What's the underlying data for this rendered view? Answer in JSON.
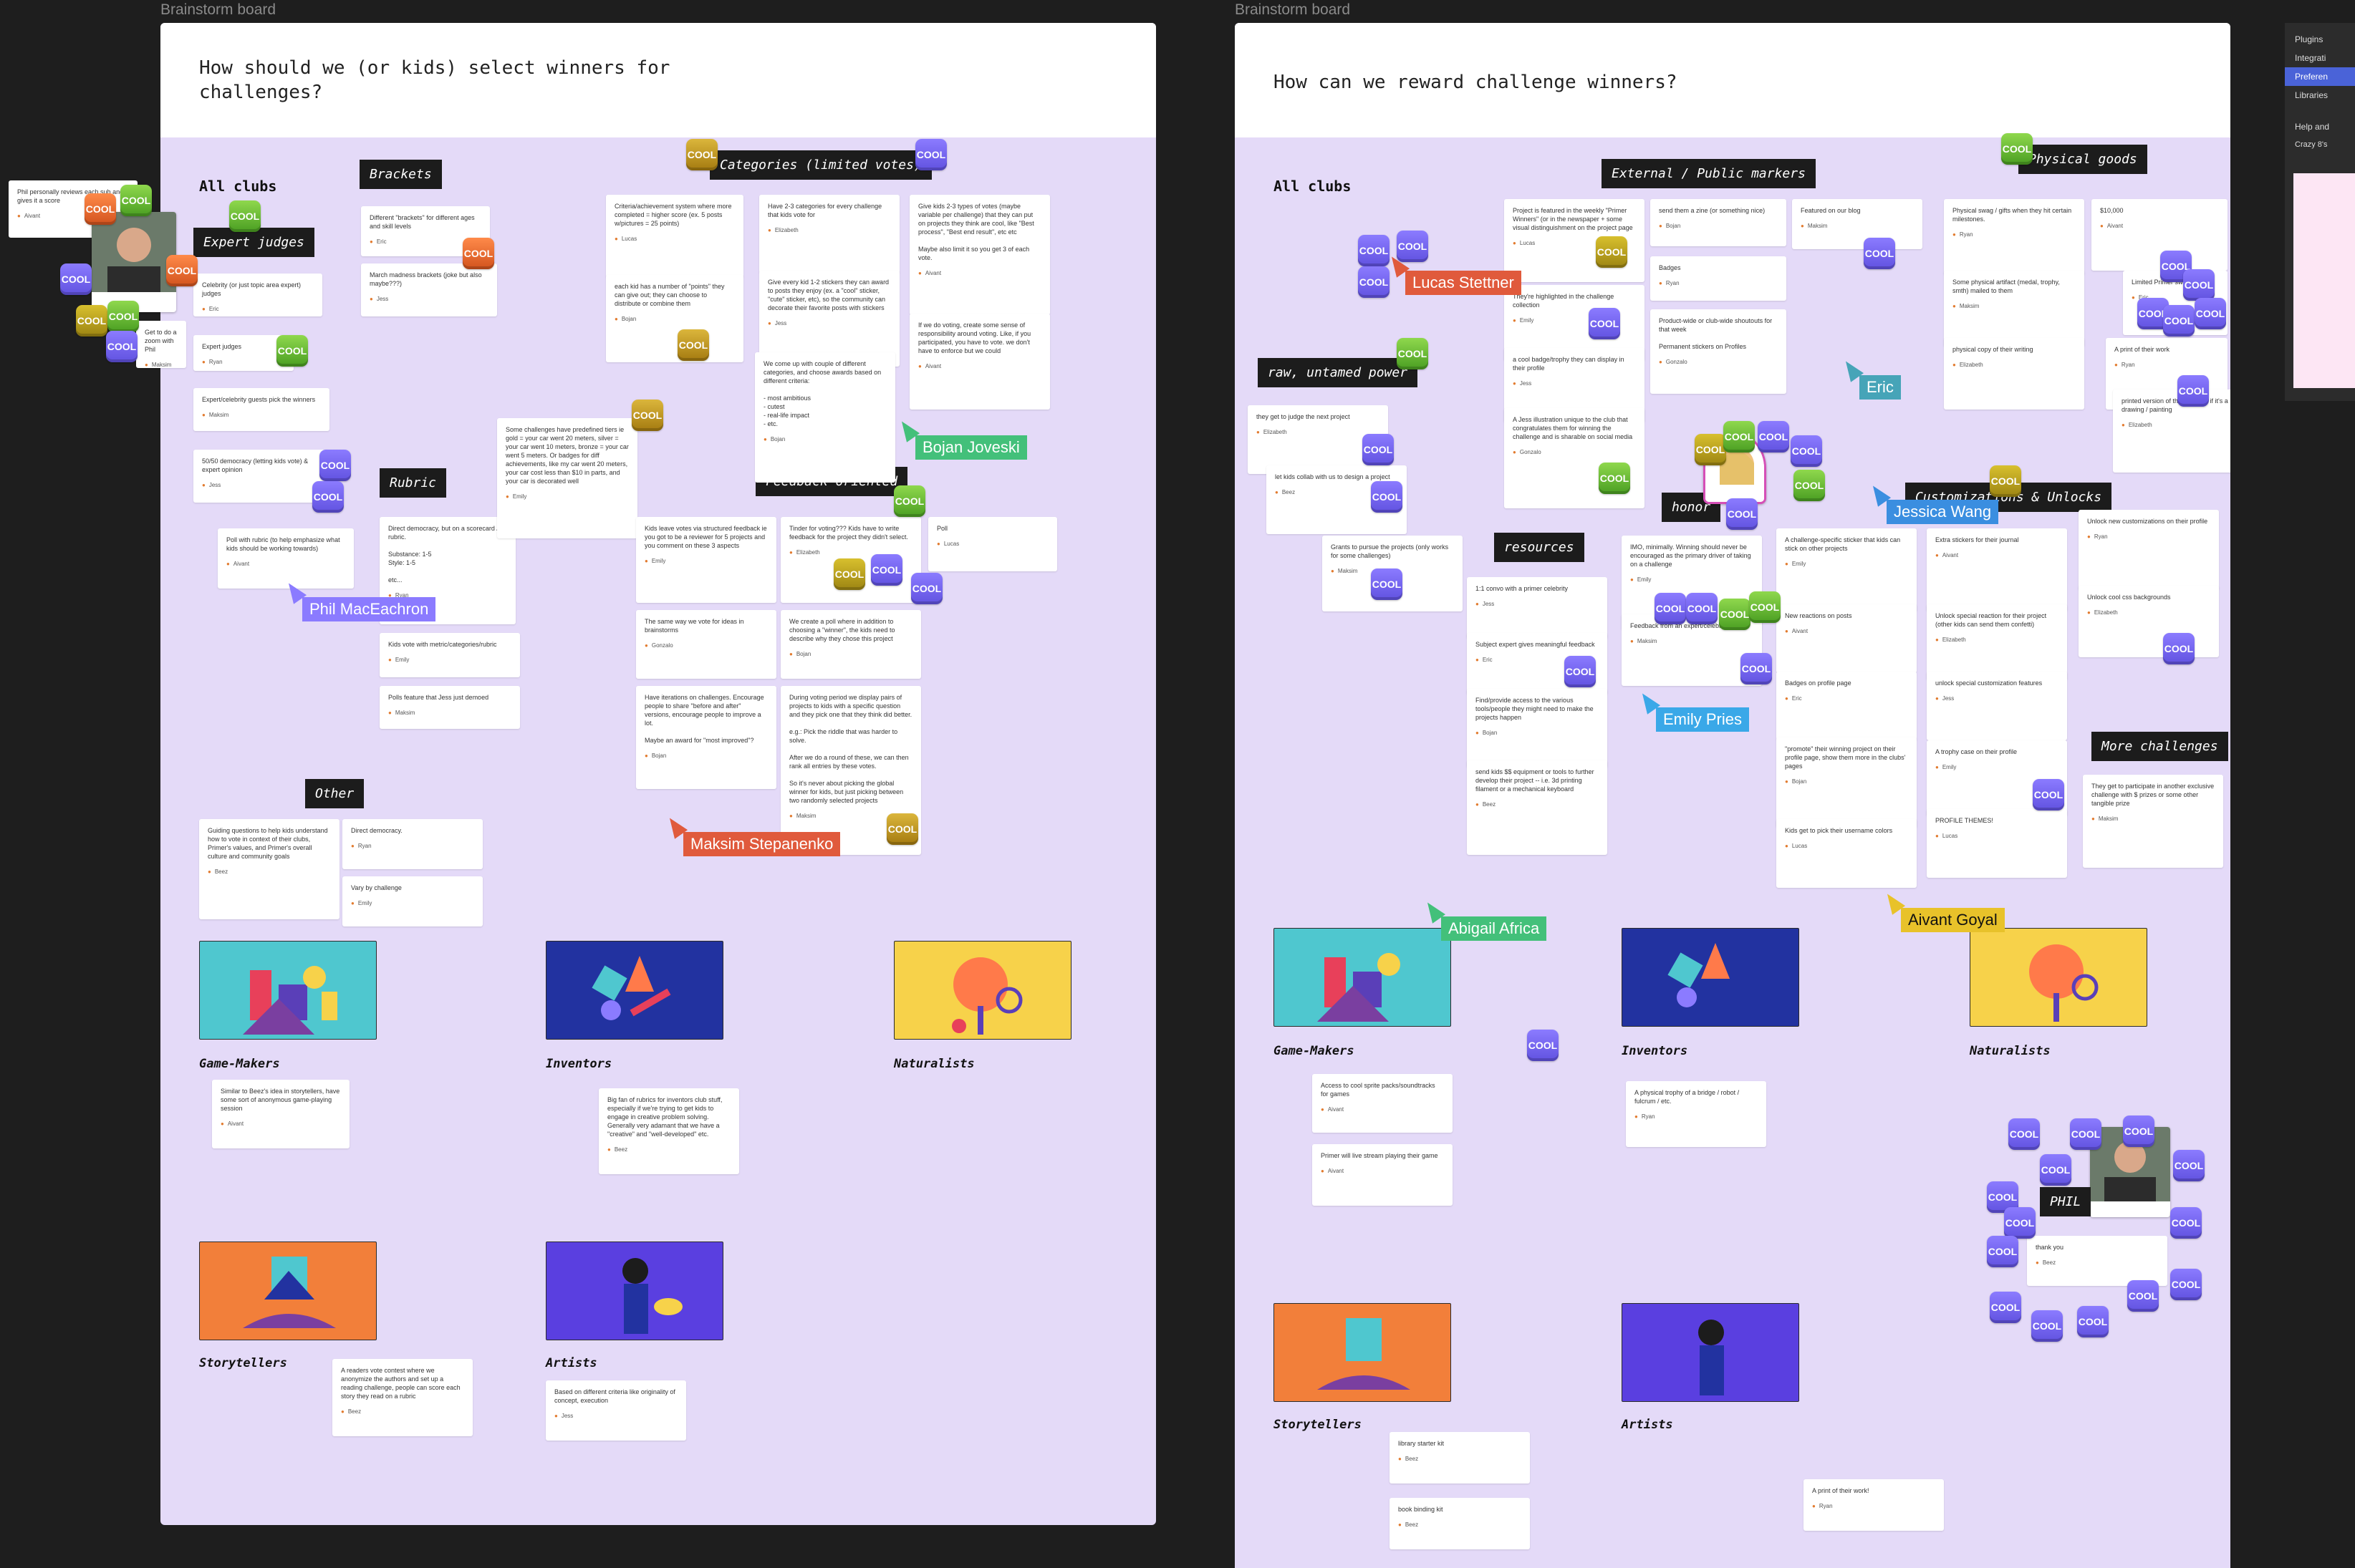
{
  "boards": [
    {
      "label": "Brainstorm board",
      "question": "How should we (or kids) select winners for\nchallenges?"
    },
    {
      "label": "Brainstorm board",
      "question": "How can we reward challenge winners?"
    }
  ],
  "sections": {
    "all_clubs": "All clubs"
  },
  "tags_left": {
    "brackets": "Brackets",
    "categories": "Categories (limited votes)",
    "expert": "Expert judges",
    "rubric": "Rubric",
    "feedback": "Feedback oriented",
    "other": "Other"
  },
  "tags_right": {
    "external": "External / Public markers",
    "physical": "Physical goods",
    "raw": "raw, untamed power",
    "resources": "resources",
    "honor": "honor",
    "unlocks": "Customizations & Unlocks",
    "more": "More challenges",
    "phil": "PHIL"
  },
  "cool_label": "COOL",
  "clubs": {
    "game": "Game-Makers",
    "inventors": "Inventors",
    "naturalists": "Naturalists",
    "story": "Storytellers",
    "artists": "Artists"
  },
  "cursors": {
    "phil": "Phil MacEachron",
    "bojan": "Bojan Joveski",
    "maksim": "Maksim Stepanenko",
    "lucas": "Lucas Stettner",
    "eric": "Eric",
    "jessica": "Jessica Wang",
    "emily": "Emily Pries",
    "abigail": "Abigail Africa",
    "aivant": "Aivant Goyal"
  },
  "notes_left": [
    {
      "t": "Phil personally reviews each sub and gives it a score",
      "a": "Aivant"
    },
    {
      "t": "Celebrity (or just topic area expert) judges",
      "a": "Eric"
    },
    {
      "t": "Expert judges",
      "a": "Ryan"
    },
    {
      "t": "Expert/celebrity guests pick the winners",
      "a": "Maksim"
    },
    {
      "t": "50/50 democracy (letting kids vote) &\nexpert opinion",
      "a": "Jess"
    },
    {
      "t": "Poll with rubric (to help emphasize what kids should be working towards)",
      "a": "Aivant"
    },
    {
      "t": "Different \"brackets\" for different ages and skill levels",
      "a": "Eric"
    },
    {
      "t": "March madness brackets (joke but also maybe???)",
      "a": "Jess"
    },
    {
      "t": "Direct democracy, but on a scorecard / rubric.\n\nSubstance: 1-5\nStyle: 1-5\n\netc...",
      "a": "Ryan"
    },
    {
      "t": "Kids vote with metric/categories/rubric",
      "a": "Emily"
    },
    {
      "t": "Polls feature that Jess just demoed",
      "a": "Maksim"
    },
    {
      "t": "Some challenges have predefined tiers ie gold = your car went 20 meters, silver = your car went 10 meters, bronze = your car went 5 meters. Or badges for diff achievements, like my car went 20 meters, your car cost less than $10 in parts, and your car is decorated well",
      "a": "Emily"
    },
    {
      "t": "Criteria/achievement system where more completed = higher score (ex. 5 posts w/pictures = 25 points)",
      "a": "Lucas"
    },
    {
      "t": "each kid has a number of \"points\" they can give out; they can choose to distribute or combine them",
      "a": "Bojan"
    },
    {
      "t": "Have 2-3 categories for every challenge that kids vote for",
      "a": "Elizabeth"
    },
    {
      "t": "Give every kid 1-2 stickers they can award to posts they enjoy (ex. a \"cool\" sticker, \"cute\" sticker, etc), so the community can decorate their favorite posts with stickers",
      "a": "Jess"
    },
    {
      "t": "We come up with couple of different categories, and choose awards based on different criteria:\n\n- most ambitious\n- cutest\n- real-life impact\n- etc.",
      "a": "Bojan"
    },
    {
      "t": "Give kids 2-3 types of votes (maybe variable per challenge) that they can put on projects they think are cool, like \"Best process\", \"Best end result\", etc etc\n\nMaybe also limit it so you get 3 of each vote.",
      "a": "Aivant"
    },
    {
      "t": "If we do voting, create some sense of responsibility around voting. Like, if you participated, you have to vote. we don't have to enforce but we could",
      "a": "Aivant"
    },
    {
      "t": "Kids leave votes via structured feedback ie you got to be a reviewer for 5 projects and you comment on these 3 aspects",
      "a": "Emily"
    },
    {
      "t": "Tinder for voting??? Kids have to write feedback for the project they didn't select.",
      "a": "Elizabeth"
    },
    {
      "t": "Poll",
      "a": "Lucas"
    },
    {
      "t": "The same way we vote for ideas in brainstorms",
      "a": "Gonzalo"
    },
    {
      "t": "We create a poll where in addition to choosing a \"winner\", the kids need to describe why they chose this project",
      "a": "Bojan"
    },
    {
      "t": "Have iterations on challenges. Encourage people to share \"before and after\" versions, encourage people to improve a lot.\n\nMaybe an award for \"most improved\"?",
      "a": "Bojan"
    },
    {
      "t": "During voting period we display pairs of projects to kids with a specific question and they pick one that they think did better.\n\ne.g.: Pick the riddle that was harder to solve.\n\nAfter we do a round of these, we can then rank all entries by these votes.\n\nSo it's never about picking the global winner for kids, but just picking between two randomly selected projects",
      "a": "Maksim"
    },
    {
      "t": "Guiding questions to help kids understand how to vote in context of their clubs, Primer's values, and Primer's overall culture and community goals",
      "a": "Beez"
    },
    {
      "t": "Direct democracy.",
      "a": "Ryan"
    },
    {
      "t": "Vary by challenge",
      "a": "Emily"
    },
    {
      "t": "Similar to Beez's idea in storytellers, have some sort of anonymous game-playing session",
      "a": "Aivant"
    },
    {
      "t": "Big fan of rubrics for inventors club stuff, especially if we're trying to get kids to engage in creative problem solving. Generally very adamant that we have a \"creative\" and \"well-developed\" etc.",
      "a": "Beez"
    },
    {
      "t": "A readers vote contest where we anonymize the authors and set up a reading challenge, people can score each story they read on a rubric",
      "a": "Beez"
    },
    {
      "t": "Based on different criteria like originality of concept, execution",
      "a": "Jess"
    }
  ],
  "notes_right": [
    {
      "t": "Project is featured in the weekly \"Primer Winners\" (or in the newspaper + some visual distinguishment on the project page",
      "a": "Lucas"
    },
    {
      "t": "send them a zine (or something nice)",
      "a": "Bojan"
    },
    {
      "t": "Featured on our blog",
      "a": "Maksim"
    },
    {
      "t": "Badges",
      "a": "Ryan"
    },
    {
      "t": "They're highlighted in the challenge collection",
      "a": "Emily"
    },
    {
      "t": "Product-wide or club-wide shoutouts for that week\n\nPermanent stickers on Profiles",
      "a": "Gonzalo"
    },
    {
      "t": "a cool badge/trophy they can display in their profile",
      "a": "Jess"
    },
    {
      "t": "A Jess illustration unique to the club that congratulates them for winning the challenge and is sharable on social media",
      "a": "Gonzalo"
    },
    {
      "t": "they get to judge the next project",
      "a": "Elizabeth"
    },
    {
      "t": "let kids collab with us to design a project",
      "a": "Beez"
    },
    {
      "t": "Grants to pursue the projects (only works for some challenges)",
      "a": "Maksim"
    },
    {
      "t": "1:1 convo with a primer celebrity",
      "a": "Jess"
    },
    {
      "t": "Subject expert gives meaningful feedback",
      "a": "Eric"
    },
    {
      "t": "Find/provide access to the various tools/people they might need to make the projects happen",
      "a": "Bojan"
    },
    {
      "t": "send kids $$ equipment or tools to further develop their project -- i.e. 3d printing filament or a mechanical keyboard",
      "a": "Beez"
    },
    {
      "t": "IMO, minimally. Winning should never be encouraged as the primary driver of taking on a challenge",
      "a": "Emily"
    },
    {
      "t": "Feedback from an expert/celebrity",
      "a": "Maksim"
    },
    {
      "t": "Physical swag / gifts when they hit certain milestones.",
      "a": "Ryan"
    },
    {
      "t": "Some physical artifact (medal, trophy, smth) mailed to them",
      "a": "Maksim"
    },
    {
      "t": "physical copy of their writing",
      "a": "Elizabeth"
    },
    {
      "t": "$10,000",
      "a": "Aivant"
    },
    {
      "t": "Limited Primer swag",
      "a": "Eric"
    },
    {
      "t": "A print of their work",
      "a": "Ryan"
    },
    {
      "t": "printed version of their artwork if it's a drawing / painting",
      "a": "Elizabeth"
    },
    {
      "t": "A challenge-specific sticker that kids can stick on other projects",
      "a": "Emily"
    },
    {
      "t": "New reactions on posts",
      "a": "Aivant"
    },
    {
      "t": "Badges on profile page",
      "a": "Eric"
    },
    {
      "t": "\"promote\" their winning project on their profile page, show them more in the clubs' pages",
      "a": "Bojan"
    },
    {
      "t": "Kids get to pick their username colors",
      "a": "Lucas"
    },
    {
      "t": "Extra stickers for their journal",
      "a": "Aivant"
    },
    {
      "t": "Unlock special reaction for their project (other kids can send them confetti)",
      "a": "Elizabeth"
    },
    {
      "t": "unlock special customization features",
      "a": "Jess"
    },
    {
      "t": "A trophy case on their profile",
      "a": "Emily"
    },
    {
      "t": "PROFILE THEMES!",
      "a": "Lucas"
    },
    {
      "t": "Unlock new customizations on their profile",
      "a": "Ryan"
    },
    {
      "t": "Unlock cool css backgrounds",
      "a": "Elizabeth"
    },
    {
      "t": "They get to participate in another exclusive challenge with $ prizes or some other tangible prize",
      "a": "Maksim"
    },
    {
      "t": "Access to cool sprite packs/soundtracks for games",
      "a": "Aivant"
    },
    {
      "t": "Primer will live stream playing their game",
      "a": "Aivant"
    },
    {
      "t": "A physical trophy of a bridge / robot / fulcrum / etc.",
      "a": "Ryan"
    },
    {
      "t": "library starter kit",
      "a": "Beez"
    },
    {
      "t": "book binding kit",
      "a": "Beez"
    },
    {
      "t": "A print of their work!",
      "a": "Ryan"
    },
    {
      "t": "Get to do a zoom with Phil",
      "a": "Maksim"
    },
    {
      "t": "thank you",
      "a": "Beez"
    }
  ],
  "sidebar": {
    "items": [
      "Plugins",
      "Integrati",
      "Preferen",
      "Libraries",
      "Help and"
    ],
    "active": 2,
    "sub": "Crazy 8's"
  },
  "colors": {
    "board_bg": "#e4daf8",
    "canvas": "#1e1e1e",
    "cool_purple": "#6f5ff0"
  }
}
